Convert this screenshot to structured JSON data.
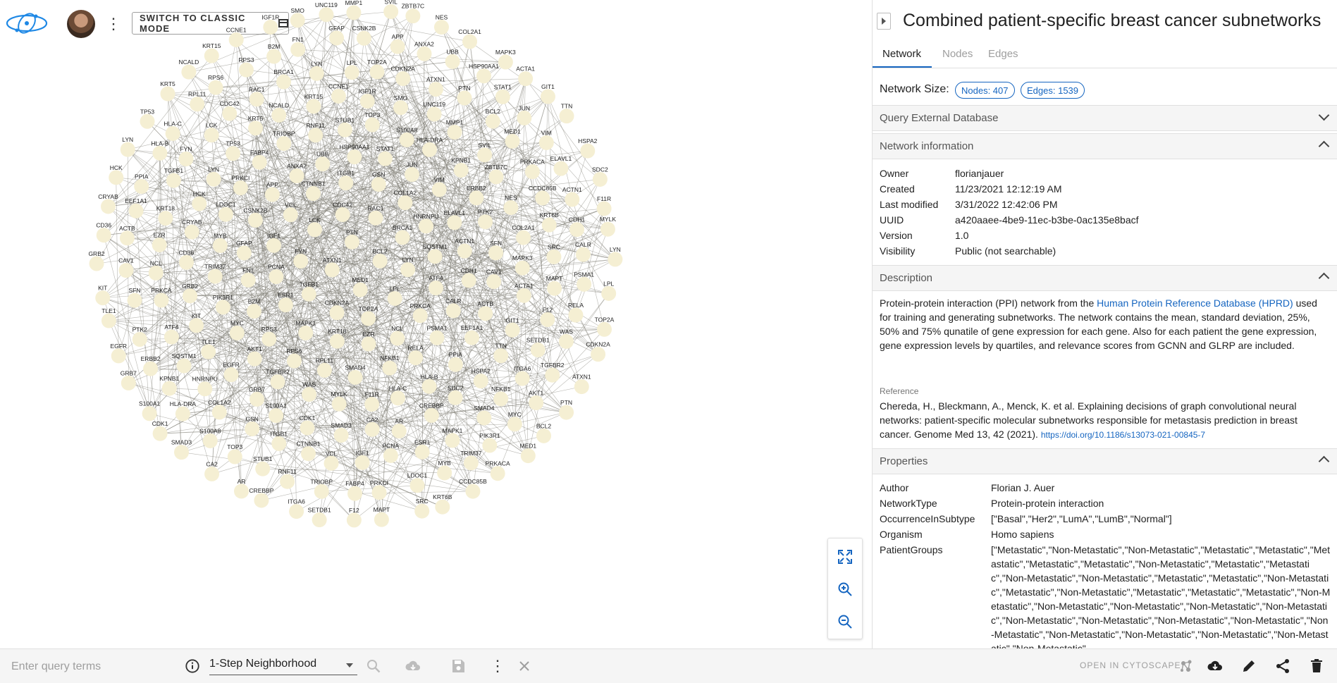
{
  "header": {
    "classic_mode_label": "SWITCH TO CLASSIC MODE"
  },
  "panel": {
    "title": "Combined patient-specific breast cancer subnetworks",
    "tabs": [
      "Network",
      "Nodes",
      "Edges"
    ],
    "network_size_label": "Network Size:",
    "nodes_chip": "Nodes: 407",
    "edges_chip": "Edges: 1539",
    "query_external": "Query External Database",
    "network_info": {
      "header": "Network information",
      "rows": [
        {
          "k": "Owner",
          "v": "florianjauer"
        },
        {
          "k": "Created",
          "v": "11/23/2021 12:12:19 AM"
        },
        {
          "k": "Last modified",
          "v": "3/31/2022 12:42:06 PM"
        },
        {
          "k": "UUID",
          "v": "a420aaee-4be9-11ec-b3be-0ac135e8bacf"
        },
        {
          "k": "Version",
          "v": "1.0"
        },
        {
          "k": "Visibility",
          "v": "Public (not searchable)"
        }
      ]
    },
    "description": {
      "header": "Description",
      "text_before": "Protein-protein interaction (PPI) network from the ",
      "link": "Human Protein Reference Database (HPRD)",
      "text_after": " used for training and generating subnetworks. The network contains the mean, standard deviation, 25%, 50% and 75% qunatile of gene expression for each gene. Also for each patient the gene expression, gene expression levels by quartiles, and relevance scores from GCNN and GLRP are included.",
      "reference_label": "Reference",
      "reference_text": "Chereda, H., Bleckmann, A., Menck, K. et al. Explaining decisions of graph convolutional neural networks: patient-specific molecular subnetworks responsible for metastasis prediction in breast cancer. Genome Med 13, 42 (2021). ",
      "reference_link": "https://doi.org/10.1186/s13073-021-00845-7"
    },
    "properties": {
      "header": "Properties",
      "rows": [
        {
          "k": "Author",
          "v": "Florian J. Auer"
        },
        {
          "k": "NetworkType",
          "v": "Protein-protein interaction"
        },
        {
          "k": "OccurrenceInSubtype",
          "v": "[\"Basal\",\"Her2\",\"LumA\",\"LumB\",\"Normal\"]"
        },
        {
          "k": "Organism",
          "v": "Homo sapiens"
        }
      ],
      "patient_groups_key": "PatientGroups",
      "patient_groups_value": "[\"Metastatic\",\"Non-Metastatic\",\"Non-Metastatic\",\"Metastatic\",\"Metastatic\",\"Metastatic\",\"Metastatic\",\"Metastatic\",\"Non-Metastatic\",\"Metastatic\",\"Metastatic\",\"Non-Metastatic\",\"Non-Metastatic\",\"Metastatic\",\"Metastatic\",\"Non-Metastatic\",\"Metastatic\",\"Non-Metastatic\",\"Metastatic\",\"Metastatic\",\"Metastatic\",\"Non-Metastatic\",\"Non-Metastatic\",\"Non-Metastatic\",\"Non-Metastatic\",\"Non-Metastatic\",\"Non-Metastatic\",\"Non-Metastatic\",\"Non-Metastatic\",\"Non-Metastatic\",\"Non-Metastatic\",\"Non-Metastatic\",\"Non-Metastatic\",\"Non-Metastatic\",\"Non-Metastatic\",\"Non-Metastatic\""
    }
  },
  "bottom": {
    "query_placeholder": "Enter query terms",
    "neighborhood": "1-Step Neighborhood",
    "open_cytoscape": "OPEN IN CYTOSCAPE"
  },
  "graph": {
    "node_color": "#f5efd3",
    "edge_color": "#7d7b73",
    "labels": [
      "LYN",
      "LPL",
      "TOP2A",
      "CDKN2A",
      "ATXN1",
      "PTN",
      "BCL2",
      "MED1",
      "PRKACA",
      "CCDC85B",
      "KRT6B",
      "SRC",
      "MAPT",
      "F12",
      "SETDB1",
      "ITGA6",
      "CREBBP",
      "AR",
      "CA2",
      "SMAD3",
      "CDK1",
      "S100A1",
      "GRB7",
      "EGFR",
      "TLE1",
      "KIT",
      "GRB2",
      "CD36",
      "CRYAB",
      "HCK",
      "LYN",
      "TP53",
      "KRT5",
      "NCALD",
      "KRT15",
      "CCNE1",
      "IGF1R",
      "SMO",
      "UNC119",
      "MMP1",
      "SVIL",
      "ZBTB7C",
      "NES",
      "COL2A1",
      "MAPK3",
      "ACTA1",
      "GIT1",
      "TTN",
      "HSPA2",
      "SDC2",
      "F11R",
      "MYLK",
      "WAS",
      "TGFBR2",
      "AKT1",
      "MYC",
      "PIK3R1",
      "TRIM37",
      "MYB",
      "LDOC1",
      "PRKCI",
      "FABP4",
      "TRIOBP",
      "RNF11",
      "STUB1",
      "TOP3",
      "S100A8",
      "HLA-DRA",
      "KPNB1",
      "ERBB2",
      "PTK2",
      "SFN",
      "CAV1",
      "ACTB",
      "EEF1A1",
      "PPIA",
      "HLA-B",
      "HLA-C",
      "RPL11",
      "RPS6",
      "RPS3",
      "B2M",
      "FN1",
      "GFAP",
      "CSNK2B",
      "APP",
      "ANXA2",
      "UBB",
      "HSP90AA1",
      "STAT1",
      "JUN",
      "VIM",
      "ELAVL1",
      "ACTN1",
      "CDH1",
      "CALR",
      "PSMA1",
      "RELA",
      "NFKB1",
      "SMAD4",
      "MAPK1",
      "ESR1",
      "PCNA",
      "IGF1",
      "VCL",
      "CTNNB1",
      "ITGB1",
      "GSN",
      "COL1A2",
      "HNRNPU",
      "SQSTM1",
      "ATF4",
      "PRKCA",
      "NCL",
      "EZR",
      "KRT18",
      "TGFB1",
      "FYN",
      "LCK",
      "CDC42",
      "RAC1",
      "BRCA1"
    ]
  }
}
